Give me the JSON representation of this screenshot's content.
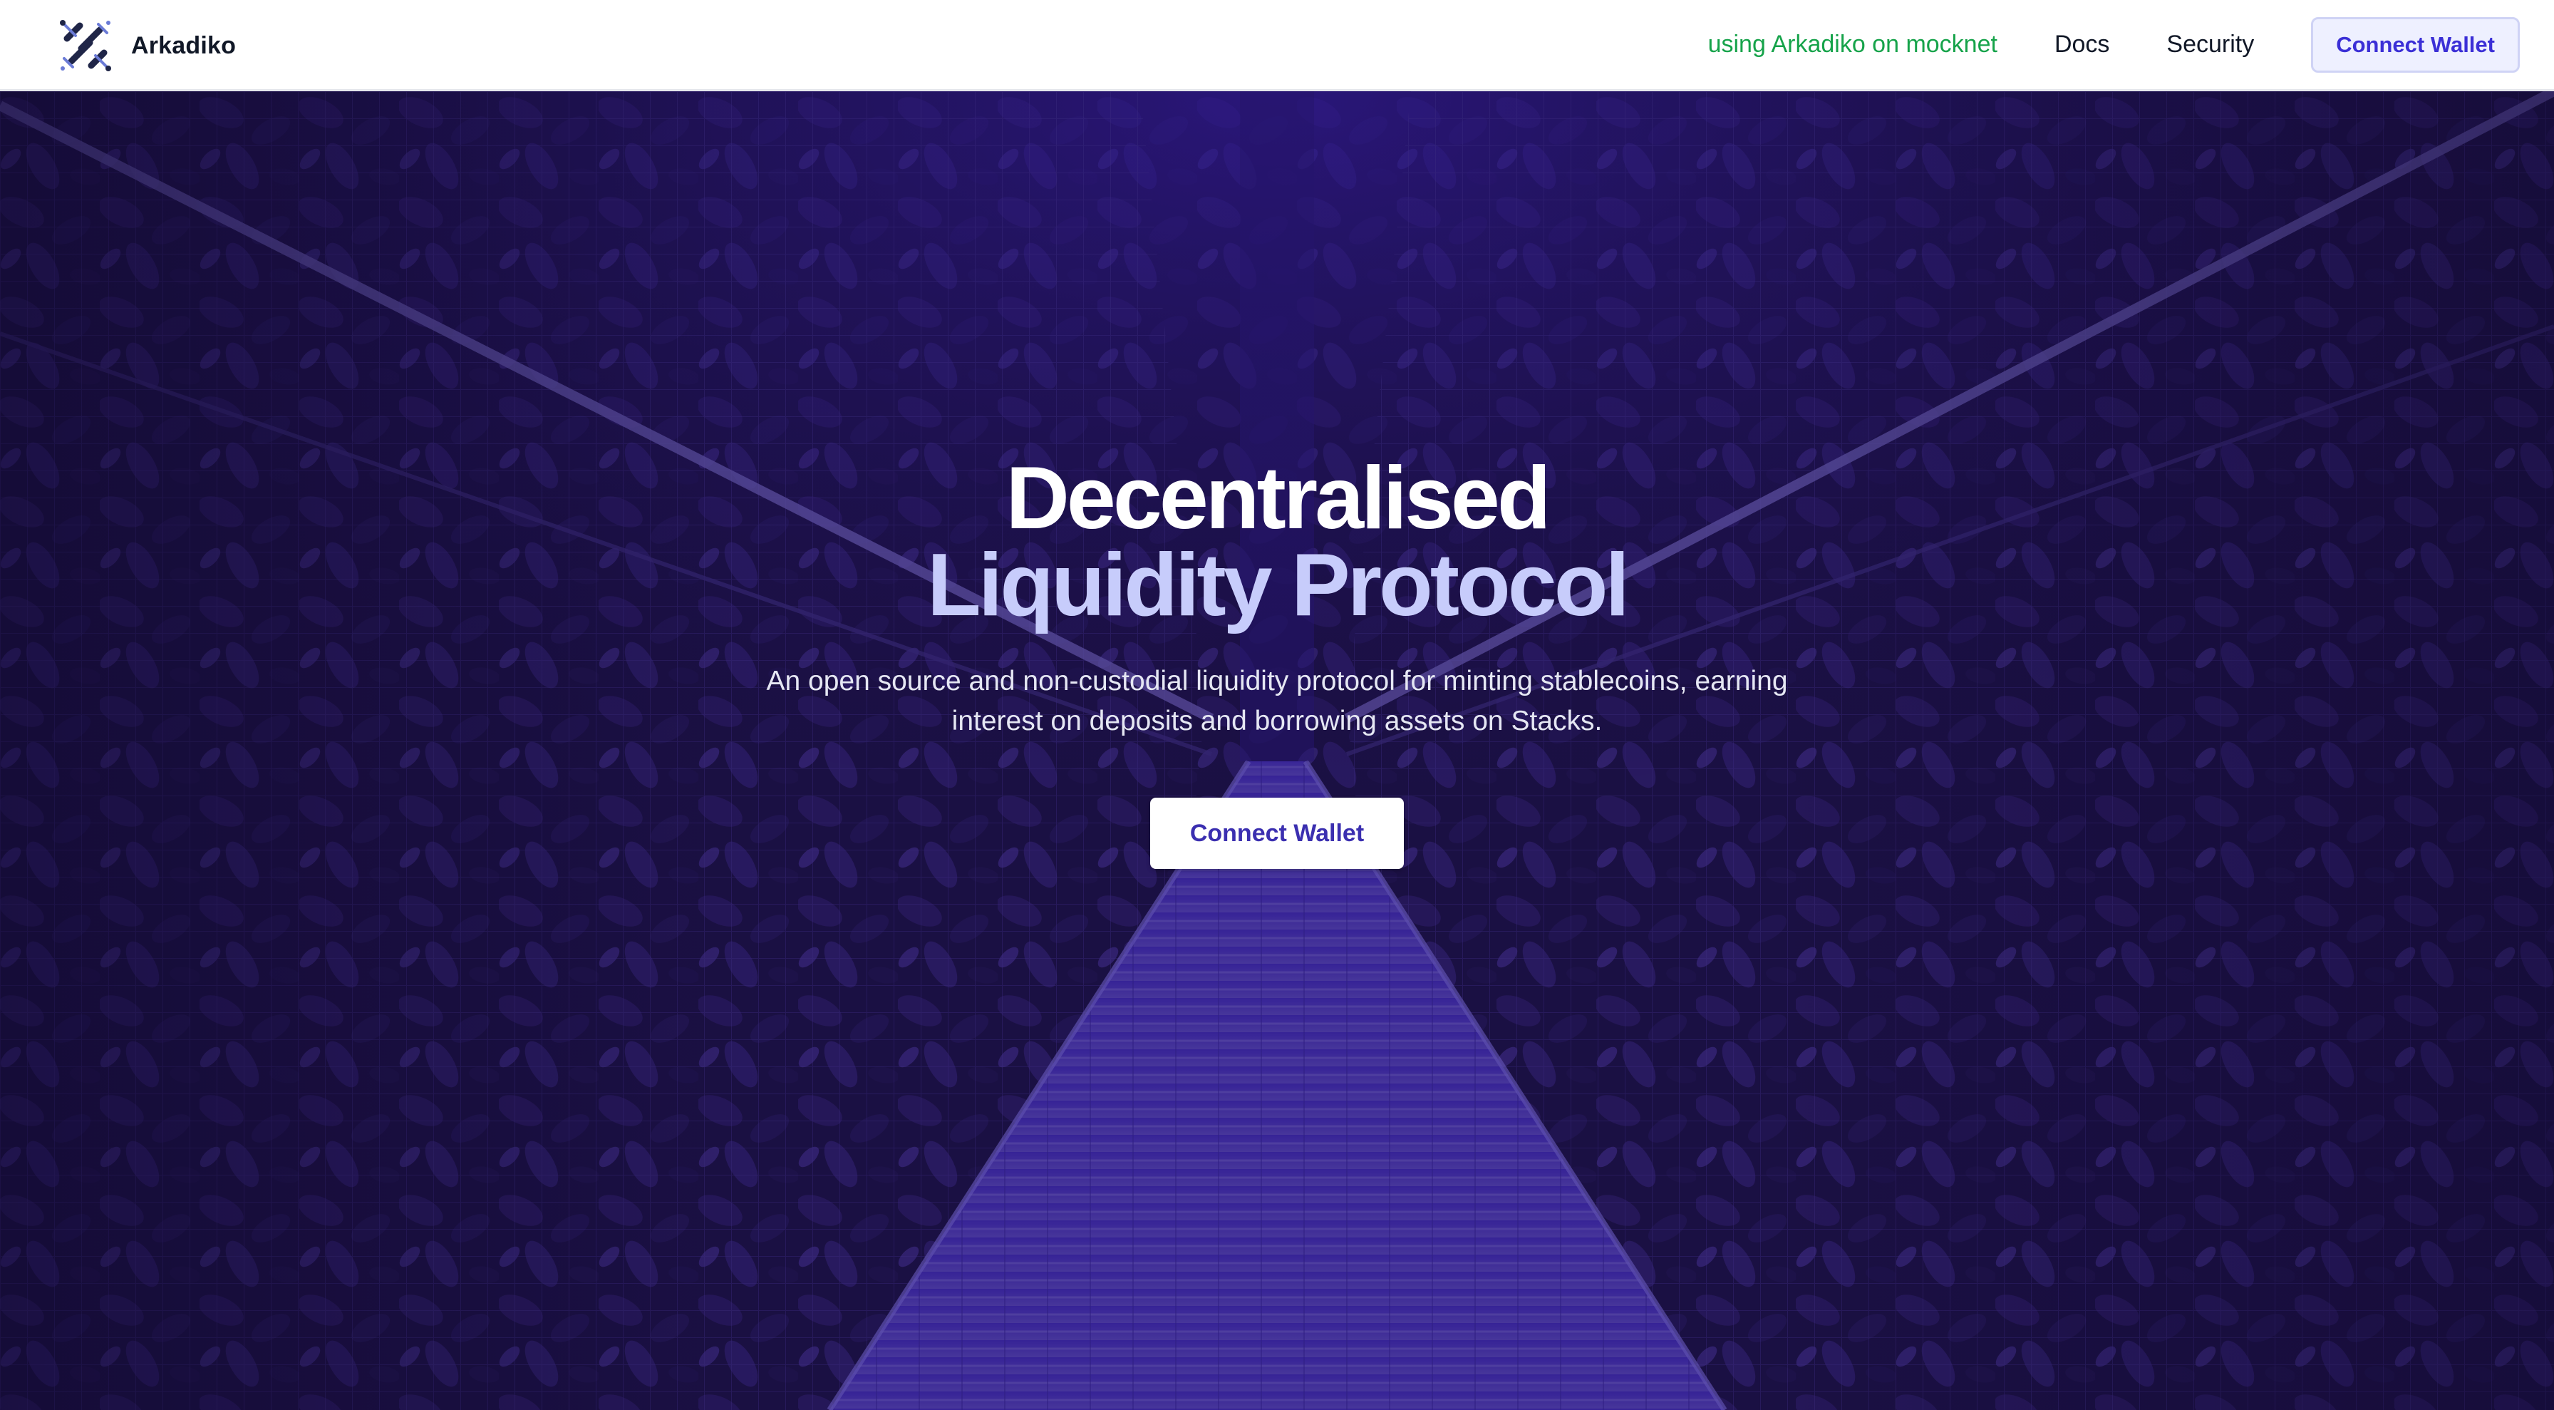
{
  "navbar": {
    "brand_name": "Arkadiko",
    "network_status": "using Arkadiko on mocknet",
    "links": [
      {
        "label": "Docs"
      },
      {
        "label": "Security"
      }
    ],
    "connect_label": "Connect Wallet"
  },
  "hero": {
    "title_line1": "Decentralised",
    "title_line2": "Liquidity Protocol",
    "subtitle": "An open source and non-custodial liquidity protocol for minting stablecoins, earning interest on deposits and borrowing assets on Stacks.",
    "cta_label": "Connect Wallet",
    "background_icon": "suspension-bridge-forest-photo"
  },
  "colors": {
    "brand_accent": "#3b2fd6",
    "network_status": "#16a34a",
    "hero_overlay": "#1e0f5c",
    "title_accent": "#c7ccfb"
  }
}
